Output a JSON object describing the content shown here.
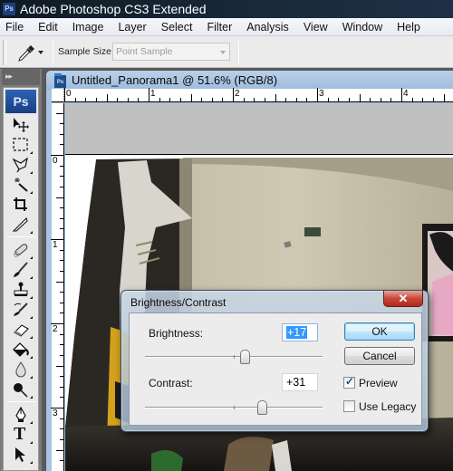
{
  "app": {
    "logo_text": "Ps",
    "title": "Adobe Photoshop CS3 Extended"
  },
  "menubar": {
    "items": [
      "File",
      "Edit",
      "Image",
      "Layer",
      "Select",
      "Filter",
      "Analysis",
      "View",
      "Window",
      "Help"
    ]
  },
  "options_bar": {
    "tool_icon": "eyedropper-icon",
    "sample_size_label": "Sample Size:",
    "sample_size_value": "Point Sample"
  },
  "toolbox": {
    "header_glyph": "▸▸",
    "ps_badge": "Ps",
    "tools": [
      {
        "name": "move-tool",
        "icon": "move-icon"
      },
      {
        "name": "marquee-tool",
        "icon": "rect-marquee-icon"
      },
      {
        "name": "lasso-tool",
        "icon": "polygonal-lasso-icon"
      },
      {
        "name": "magic-wand-tool",
        "icon": "magic-wand-icon"
      },
      {
        "name": "crop-tool",
        "icon": "crop-icon"
      },
      {
        "name": "slice-tool",
        "icon": "slice-icon"
      },
      {
        "name": "healing-brush-tool",
        "icon": "bandage-icon"
      },
      {
        "name": "brush-tool",
        "icon": "brush-icon"
      },
      {
        "name": "clone-stamp-tool",
        "icon": "stamp-icon"
      },
      {
        "name": "history-brush-tool",
        "icon": "history-brush-icon"
      },
      {
        "name": "eraser-tool",
        "icon": "eraser-icon"
      },
      {
        "name": "paint-bucket-tool",
        "icon": "bucket-icon"
      },
      {
        "name": "blur-tool",
        "icon": "drop-icon"
      },
      {
        "name": "dodge-tool",
        "icon": "burn-icon"
      },
      {
        "name": "pen-tool",
        "icon": "pen-icon"
      },
      {
        "name": "type-tool",
        "icon": "type-icon"
      },
      {
        "name": "path-selection-tool",
        "icon": "arrow-icon"
      }
    ],
    "type_glyph": "T"
  },
  "document": {
    "icon_text": "Ps",
    "title": "Untitled_Panorama1 @ 51.6% (RGB/8)",
    "zoom": "51.6%",
    "color_mode": "RGB/8",
    "ruler_top_labels": [
      "0",
      "1",
      "2",
      "3",
      "4"
    ],
    "ruler_left_labels": [
      "0",
      "1",
      "2",
      "3"
    ]
  },
  "dialog": {
    "title": "Brightness/Contrast",
    "close_glyph": "✕",
    "brightness_label": "Brightness:",
    "brightness_value": "+17",
    "brightness_slider_fraction": 0.56,
    "contrast_label": "Contrast:",
    "contrast_value": "+31",
    "contrast_slider_fraction": 0.66,
    "ok_label": "OK",
    "cancel_label": "Cancel",
    "preview_label": "Preview",
    "preview_checked": true,
    "legacy_label": "Use Legacy",
    "legacy_checked": false,
    "check_glyph": "✓"
  }
}
